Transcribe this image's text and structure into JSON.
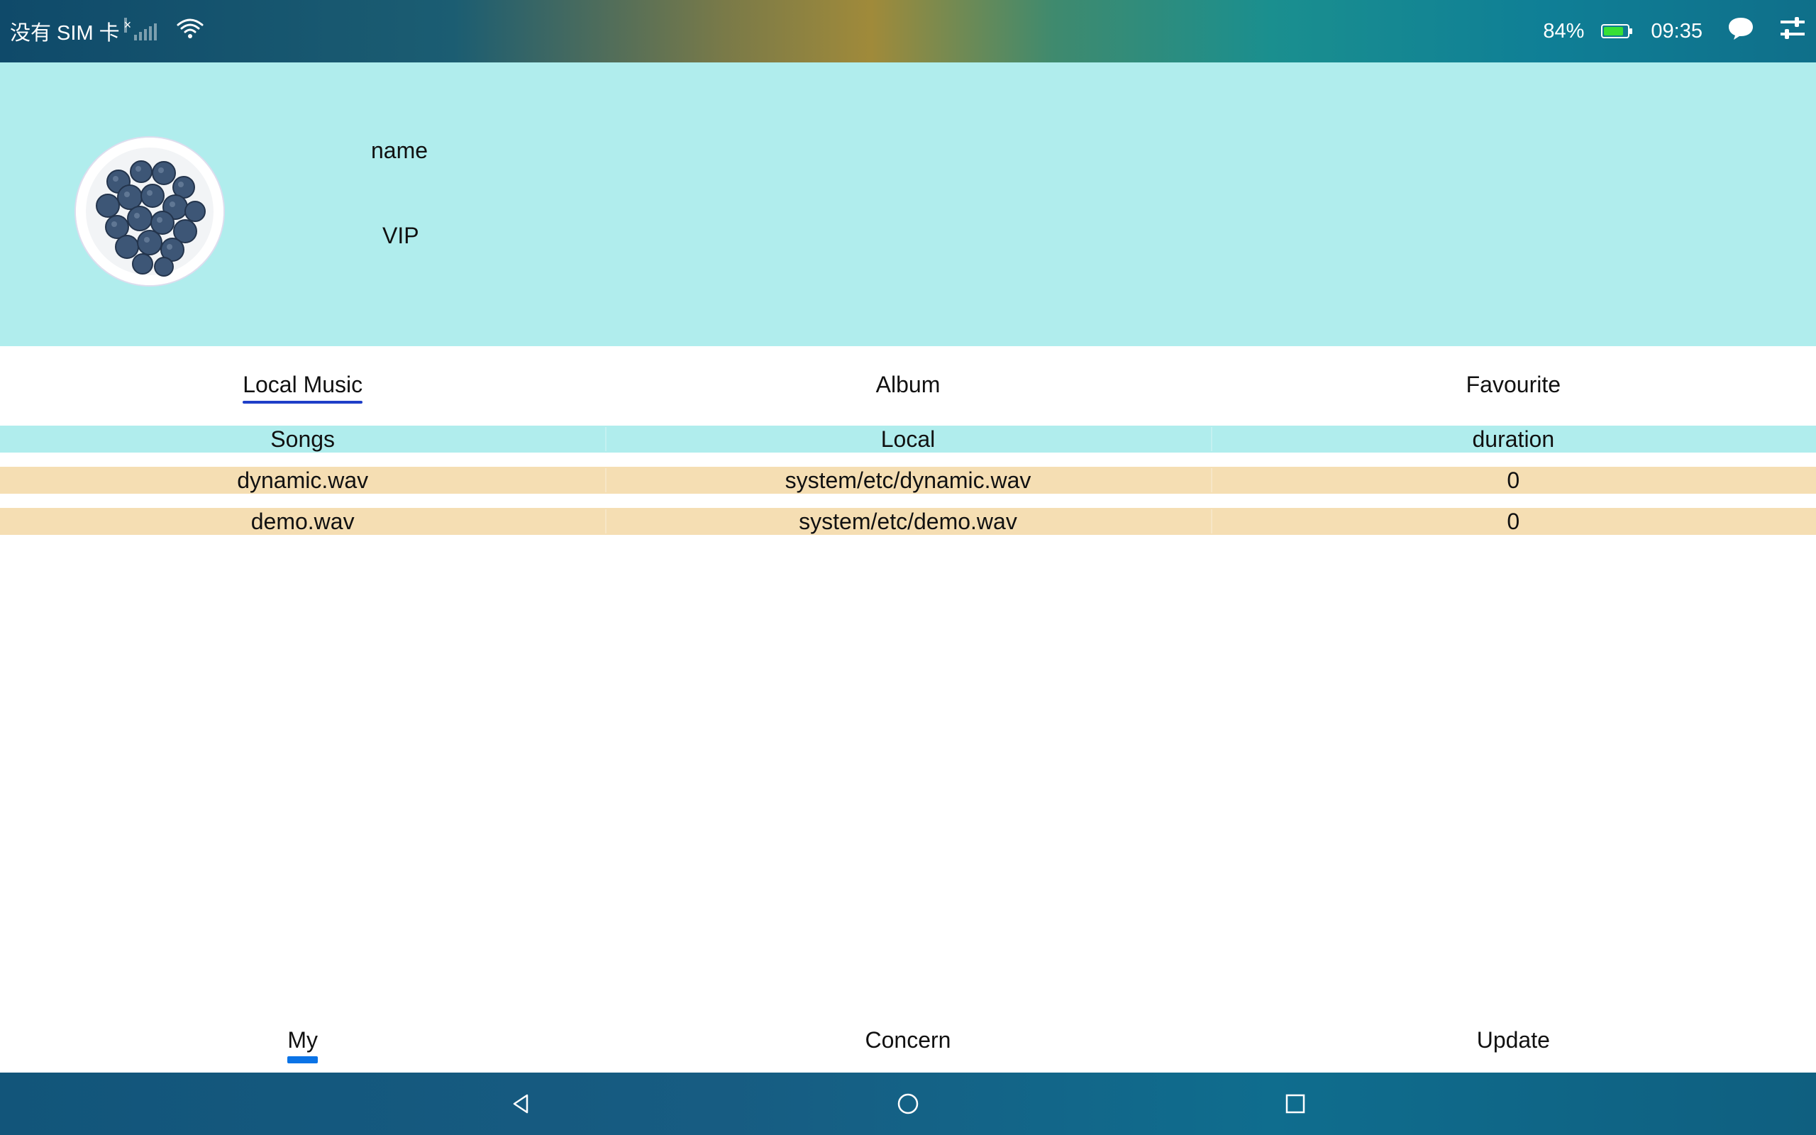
{
  "status_bar": {
    "carrier": "没有 SIM 卡",
    "no_signal_mark": "×",
    "battery_percent": "84%",
    "battery_level": 0.84,
    "time": "09:35",
    "icons": [
      "signal-icon",
      "wifi-icon",
      "battery-icon",
      "message-icon",
      "settings-sliders-icon"
    ]
  },
  "profile": {
    "name": "name",
    "vip": "VIP",
    "avatar": "blueberries-avatar"
  },
  "top_tabs": [
    {
      "label": "Local Music",
      "active": true
    },
    {
      "label": "Album",
      "active": false
    },
    {
      "label": "Favourite",
      "active": false
    }
  ],
  "table": {
    "headers": [
      "Songs",
      "Local",
      "duration"
    ],
    "rows": [
      [
        "dynamic.wav",
        "system/etc/dynamic.wav",
        "0"
      ],
      [
        "demo.wav",
        "system/etc/demo.wav",
        "0"
      ]
    ]
  },
  "bottom_tabs": [
    {
      "label": "My",
      "active": true
    },
    {
      "label": "Concern",
      "active": false
    },
    {
      "label": "Update",
      "active": false
    }
  ],
  "nav_bar": {
    "icons": [
      "back-icon",
      "home-icon",
      "recents-icon"
    ]
  },
  "colors": {
    "header_bg": "#b0eded",
    "row_bg": "#f5deb3",
    "tab_indicator": "#1f3fc8",
    "bottom_indicator": "#0a73e6",
    "battery_fill": "#36e036"
  }
}
